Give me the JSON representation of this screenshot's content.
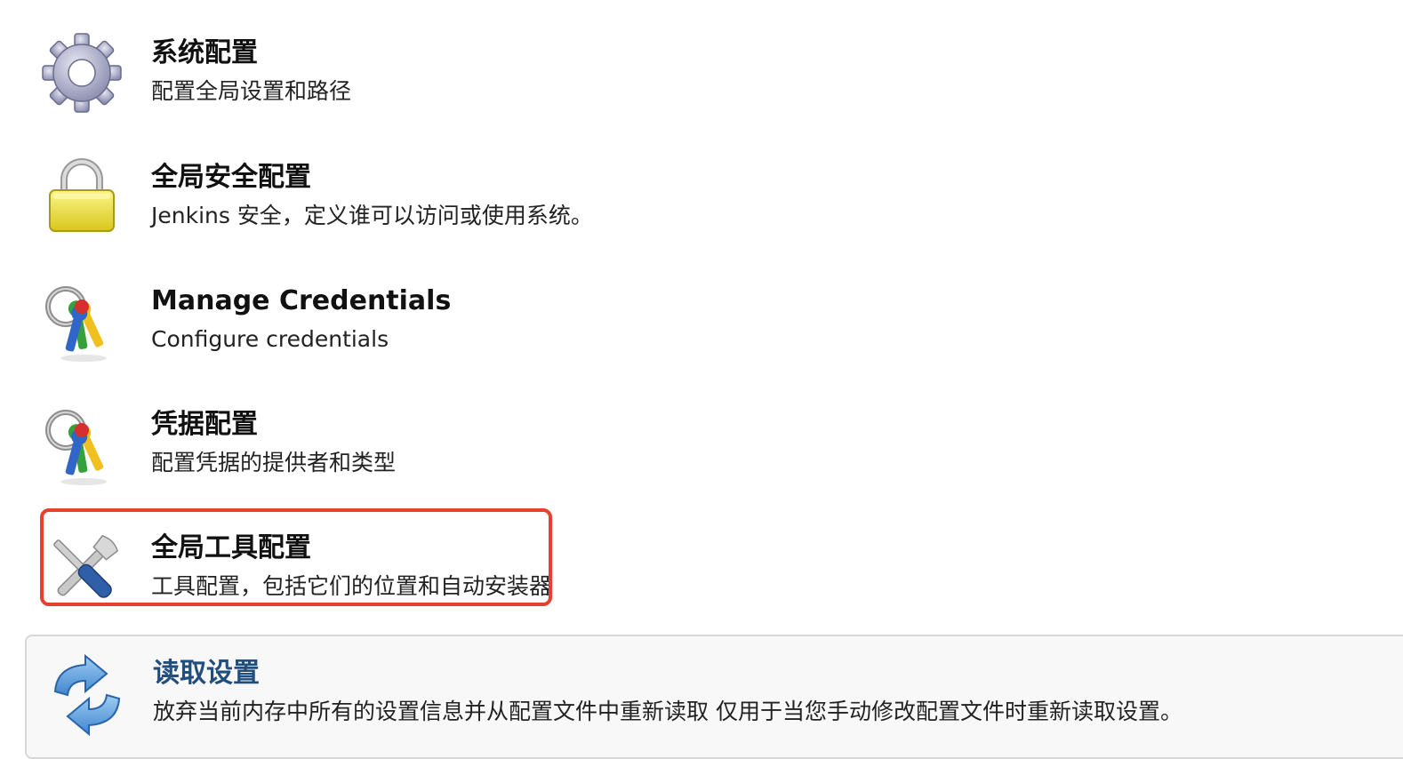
{
  "items": [
    {
      "title": "系统配置",
      "desc": "配置全局设置和路径",
      "icon": "gear-icon"
    },
    {
      "title": "全局安全配置",
      "desc": "Jenkins 安全，定义谁可以访问或使用系统。",
      "icon": "lock-icon"
    },
    {
      "title": "Manage Credentials",
      "desc": "Configure credentials",
      "icon": "keys-icon"
    },
    {
      "title": "凭据配置",
      "desc": "配置凭据的提供者和类型",
      "icon": "keys-icon"
    },
    {
      "title": "全局工具配置",
      "desc": "工具配置，包括它们的位置和自动安装器",
      "icon": "tools-icon"
    }
  ],
  "reload": {
    "title": "读取设置",
    "desc": "放弃当前内存中所有的设置信息并从配置文件中重新读取 仅用于当您手动修改配置文件时重新读取设置。",
    "icon": "reload-icon"
  },
  "colors": {
    "highlight": "#e5412d",
    "link": "#224e7d",
    "panel_bg": "#f8f8f8"
  }
}
